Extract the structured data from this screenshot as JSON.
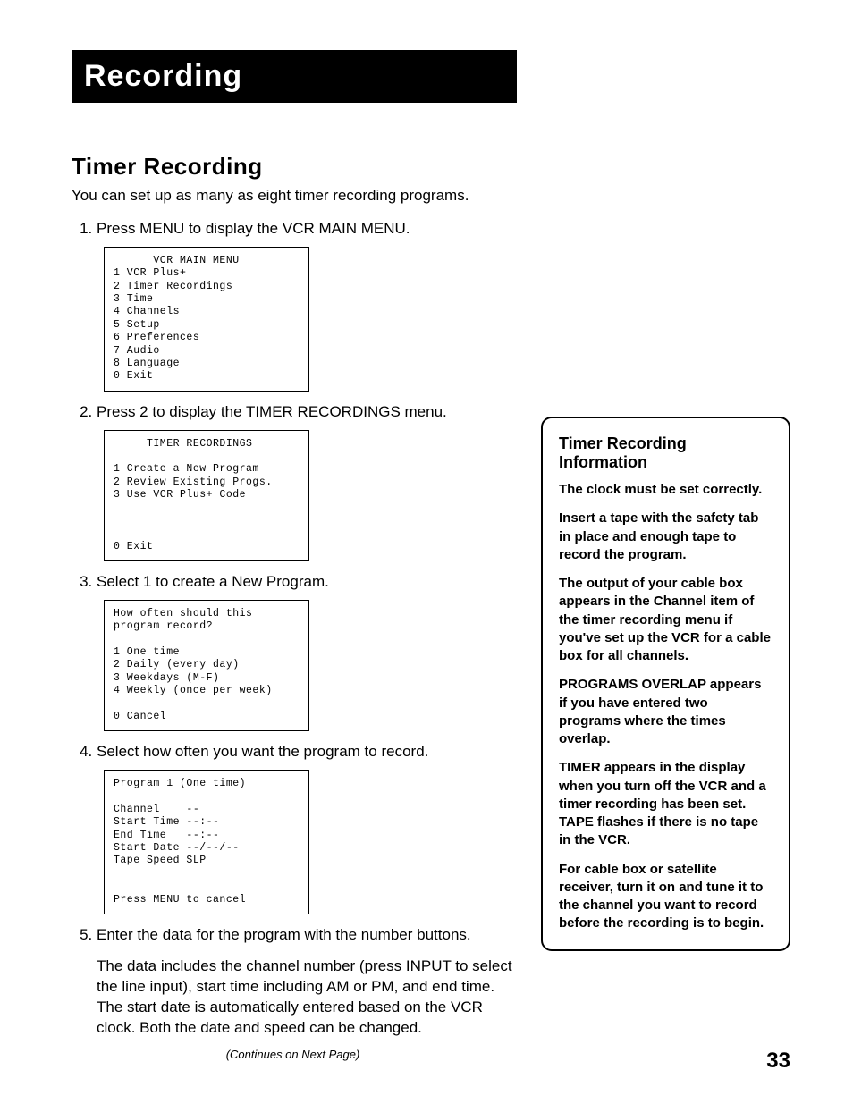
{
  "chapter_title": "Recording",
  "section_title": "Timer Recording",
  "intro": "You can set up as many as eight timer recording programs.",
  "steps": [
    {
      "text": "Press MENU to display the VCR MAIN MENU.",
      "screen": "      VCR MAIN MENU\n1 VCR Plus+\n2 Timer Recordings\n3 Time\n4 Channels\n5 Setup\n6 Preferences\n7 Audio\n8 Language\n0 Exit"
    },
    {
      "text": "Press 2 to display the TIMER RECORDINGS menu.",
      "screen": "     TIMER RECORDINGS\n\n1 Create a New Program\n2 Review Existing Progs.\n3 Use VCR Plus+ Code\n\n\n\n0 Exit"
    },
    {
      "text": "Select 1 to create a New Program.",
      "screen": "How often should this\nprogram record?\n\n1 One time\n2 Daily (every day)\n3 Weekdays (M-F)\n4 Weekly (once per week)\n\n0 Cancel"
    },
    {
      "text": "Select how often you want the program to record.",
      "screen": "Program 1 (One time)\n\nChannel    --\nStart Time --:--\nEnd Time   --:--\nStart Date --/--/--\nTape Speed SLP\n\n\nPress MENU to cancel"
    },
    {
      "text": "Enter the data for the program with the number buttons.",
      "para": "The data includes the channel number (press INPUT to select the line input), start time including AM or PM, and end time. The start date is automatically entered based on the VCR clock. Both the date and speed can be changed."
    }
  ],
  "continues": "(Continues on Next Page)",
  "infobox": {
    "title": "Timer Recording Information",
    "paras": [
      "The clock must be set correctly.",
      "Insert a tape with the safety tab in place and enough tape to record the program.",
      "The output of your cable box appears in the Channel item of the timer recording menu if you've set up the VCR for a cable box for all channels.",
      "PROGRAMS OVERLAP appears if you have entered two programs where the times overlap.",
      "TIMER appears in the display when you turn off the VCR and a timer recording has been set.  TAPE flashes if there is no tape in the VCR.",
      "For cable box or satellite receiver, turn it on and tune it to the channel you want to record before the recording is to begin."
    ]
  },
  "page_number": "33"
}
